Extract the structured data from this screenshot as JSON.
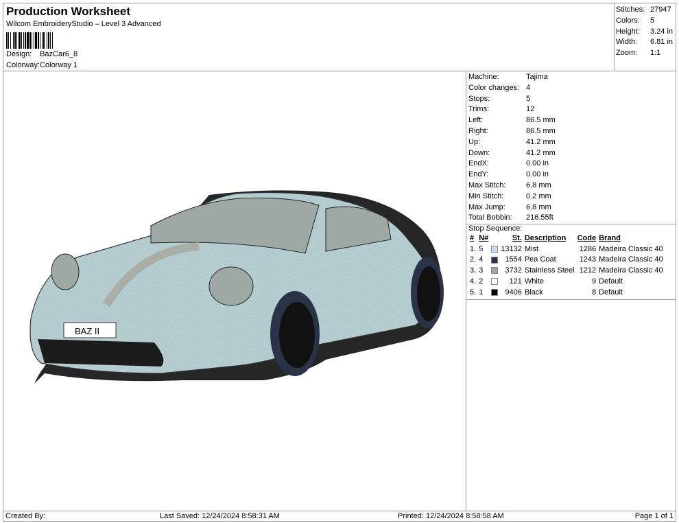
{
  "header": {
    "title": "Production Worksheet",
    "subtitle": "Wilcom EmbroideryStudio – Level 3 Advanced",
    "design_label": "Design:",
    "design": "BazCar6_8",
    "colorway_label": "Colorway:",
    "colorway": "Colorway 1"
  },
  "summary": [
    {
      "label": "Stitches:",
      "value": "27947"
    },
    {
      "label": "Colors:",
      "value": "5"
    },
    {
      "label": "Height:",
      "value": "3.24 in"
    },
    {
      "label": "Width:",
      "value": "6.81 in"
    },
    {
      "label": "Zoom:",
      "value": "1:1"
    }
  ],
  "info": [
    {
      "label": "Machine:",
      "value": "Tajima"
    },
    {
      "label": "Color changes:",
      "value": "4"
    },
    {
      "label": "Stops:",
      "value": "5"
    },
    {
      "label": "Trims:",
      "value": "12"
    },
    {
      "label": "Left:",
      "value": "86.5 mm"
    },
    {
      "label": "Right:",
      "value": "86.5 mm"
    },
    {
      "label": "Up:",
      "value": "41.2 mm"
    },
    {
      "label": "Down:",
      "value": "41.2 mm"
    },
    {
      "label": "EndX:",
      "value": "0.00 in"
    },
    {
      "label": "EndY:",
      "value": "0.00 in"
    },
    {
      "label": "Max Stitch:",
      "value": "6.8 mm"
    },
    {
      "label": "Min Stitch:",
      "value": "0.2 mm"
    },
    {
      "label": "Max Jump:",
      "value": "6.8 mm"
    },
    {
      "label": "Total Bobbin:",
      "value": "216.55ft"
    }
  ],
  "stops": {
    "title": "Stop Sequence:",
    "headers": [
      "#",
      "N#",
      "St.",
      "Description",
      "Code",
      "Brand"
    ],
    "rows": [
      {
        "num": "1.",
        "n": "5",
        "color": "#c8dcf0",
        "st": "13132",
        "desc": "Mist",
        "code": "1286",
        "brand": "Madeira Classic 40"
      },
      {
        "num": "2.",
        "n": "4",
        "color": "#2a3248",
        "st": "1554",
        "desc": "Pea Coat",
        "code": "1243",
        "brand": "Madeira Classic 40"
      },
      {
        "num": "3.",
        "n": "3",
        "color": "#a0a4a4",
        "st": "3732",
        "desc": "Stainless Steel",
        "code": "1212",
        "brand": "Madeira Classic 40"
      },
      {
        "num": "4.",
        "n": "2",
        "color": "#ffffff",
        "st": "121",
        "desc": "White",
        "code": "9",
        "brand": "Default"
      },
      {
        "num": "5.",
        "n": "1",
        "color": "#000000",
        "st": "9406",
        "desc": "Black",
        "code": "8",
        "brand": "Default"
      }
    ]
  },
  "design": {
    "plate_text": "BAZ II"
  },
  "footer": {
    "created": "Created By:",
    "saved": "Last Saved: 12/24/2024 8:58:31 AM",
    "printed": "Printed: 12/24/2024 8:58:58 AM",
    "page": "Page 1 of 1"
  }
}
